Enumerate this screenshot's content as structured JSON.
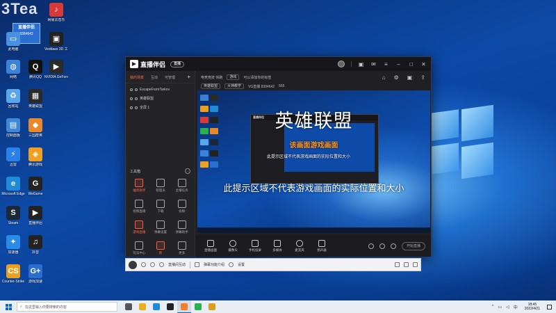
{
  "desktop": {
    "watermark": "3Tea",
    "badge": {
      "line1": "直播伴侣",
      "line2": "8384642"
    },
    "icons": [
      {
        "label": "3Tea",
        "color": "#3a7fd0",
        "glyph": "3"
      },
      {
        "label": "网易云音乐",
        "color": "#d83a3a",
        "glyph": "♪"
      },
      {
        "label": "此电脑",
        "color": "#4a90e0",
        "glyph": "▭"
      },
      {
        "label": "Veddaax 3D 工作室",
        "color": "#222",
        "glyph": "▣"
      },
      {
        "label": "NVIDIA GeForce",
        "color": "#2b2b2b",
        "glyph": "▶"
      },
      {
        "label": "网络",
        "color": "#3b82d8",
        "glyph": "◍"
      },
      {
        "label": "腾讯QQ",
        "color": "#111",
        "glyph": "Q"
      },
      {
        "label": "回收站",
        "color": "#5aa6e8",
        "glyph": "♻"
      },
      {
        "label": "英雄联盟",
        "color": "#2a2a2a",
        "glyph": "▦"
      },
      {
        "label": "控制面板",
        "color": "#3f88d8",
        "glyph": "▤"
      },
      {
        "label": "三国群英",
        "color": "#e88a2a",
        "glyph": "◆"
      },
      {
        "label": "迅雷",
        "color": "#2a7fe8",
        "glyph": "⚡"
      },
      {
        "label": "腾讯游戏",
        "color": "#f0a020",
        "glyph": "◈"
      },
      {
        "label": "Microsoft Edge",
        "color": "#1f8ad8",
        "glyph": "e"
      },
      {
        "label": "WeGame",
        "color": "#222",
        "glyph": "G"
      },
      {
        "label": "Steam",
        "color": "#1b2838",
        "glyph": "S"
      },
      {
        "label": "直播伴侣",
        "color": "#222",
        "glyph": "▶"
      },
      {
        "label": "加速器",
        "color": "#2a8ae8",
        "glyph": "✦"
      },
      {
        "label": "抖音",
        "color": "#222",
        "glyph": "♫"
      },
      {
        "label": "Counter-Strike",
        "color": "#e8a020",
        "glyph": "CS"
      },
      {
        "label": "游戏加速",
        "color": "#2a6fd0",
        "glyph": "G+"
      }
    ]
  },
  "app": {
    "title": "直播伴侣",
    "version_badge": "直播",
    "scene_tabs": [
      {
        "label": "我的场景",
        "active": true
      },
      {
        "label": "互动",
        "active": false
      },
      {
        "label": "可管理",
        "active": false
      }
    ],
    "scenes": [
      {
        "label": "EscapeFromTarkov"
      },
      {
        "label": "英雄联盟"
      },
      {
        "label": "全屏 1"
      }
    ],
    "tools_title": "工具箱",
    "tools": [
      {
        "label": "抽奖助手",
        "hot": true
      },
      {
        "label": "管理员",
        "hot": false
      },
      {
        "label": "主播任务",
        "hot": false
      },
      {
        "label": "视频直播",
        "hot": false
      },
      {
        "label": "下载",
        "hot": false
      },
      {
        "label": "投稿",
        "hot": false
      },
      {
        "label": "游戏直播",
        "hot": true
      },
      {
        "label": "弹幕设置",
        "hot": false
      },
      {
        "label": "弹幕助手",
        "hot": false
      },
      {
        "label": "玩法中心",
        "hot": false
      },
      {
        "label": "新",
        "hot": true
      },
      {
        "label": "更多",
        "hot": false
      }
    ],
    "header": {
      "live_title": "电竞竞技 快跑",
      "tag1": "游戏",
      "room_prefix": "可以添加你的标签",
      "tag2": "英雄联盟",
      "tag3": "大神教学",
      "room_id": "VG直播 8384642",
      "follow": "565"
    },
    "preview": {
      "title_overlay": "英雄联盟",
      "subtitle_overlay": "该画面游戏画面",
      "inner_hint": "此提示区域不代表游戏画面的实际位置和大小",
      "hint": "此提示区域不代表游戏画面的实际位置和大小",
      "inner_app_title": "直播伴侣"
    },
    "controls": [
      {
        "label": "直播画面",
        "shape": "square"
      },
      {
        "label": "摄像头",
        "shape": "round"
      },
      {
        "label": "手机投屏",
        "shape": "square"
      },
      {
        "label": "多媒体",
        "shape": "square"
      },
      {
        "label": "麦克风",
        "shape": "round"
      },
      {
        "label": "扬声器",
        "shape": "square"
      }
    ],
    "go_live": "开始直播"
  },
  "chat": {
    "items": [
      {
        "label": "直播间互动"
      },
      {
        "label": "弹幕功能介绍"
      },
      {
        "label": "设置"
      }
    ]
  },
  "taskbar": {
    "search_placeholder": "在这里输入你要搜索的内容",
    "time": "18:45",
    "date": "2022/4/21",
    "ime": "中",
    "apps": [
      {
        "name": "task-view",
        "color": "#555"
      },
      {
        "name": "file-explorer",
        "color": "#e8b020"
      },
      {
        "name": "edge",
        "color": "#1f8ad8"
      },
      {
        "name": "terminal",
        "color": "#222"
      },
      {
        "name": "live-companion",
        "color": "#f08030"
      },
      {
        "name": "wegame",
        "color": "#2ab050"
      },
      {
        "name": "folder",
        "color": "#d8a020"
      }
    ]
  }
}
